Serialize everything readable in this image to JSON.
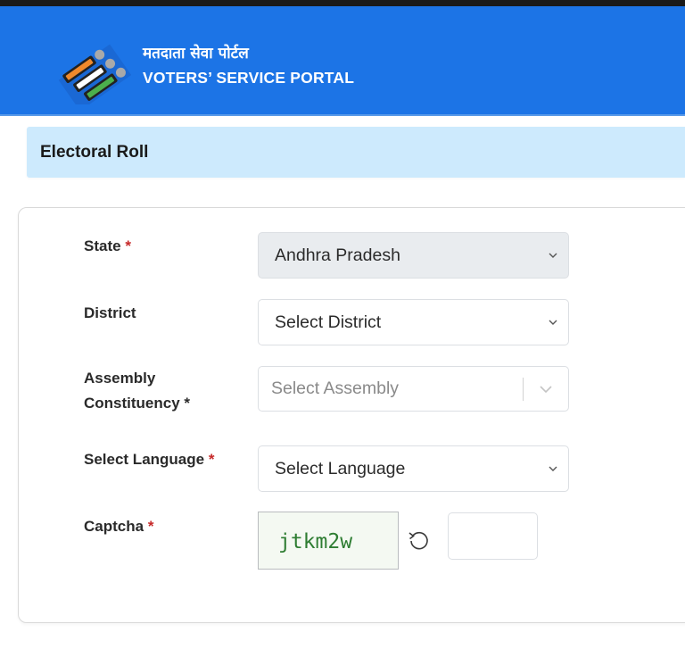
{
  "header": {
    "hindi_title": "मतदाता सेवा पोर्टल",
    "english_title": "VOTERS’ SERVICE PORTAL",
    "logo_icon": "eci-ballot-logo-icon"
  },
  "section": {
    "title": "Electoral Roll"
  },
  "form": {
    "state": {
      "label": "State",
      "required_mark": "*",
      "value": "Andhra Pradesh",
      "disabled": true
    },
    "district": {
      "label": "District",
      "value": "Select District"
    },
    "assembly": {
      "label_line1": "Assembly",
      "label_line2": "Constituency",
      "required_mark": "*",
      "placeholder": "Select Assembly"
    },
    "language": {
      "label": "Select Language",
      "required_mark": "*",
      "value": "Select Language"
    },
    "captcha": {
      "label": "Captcha",
      "required_mark": "*",
      "code": "jtkm2w",
      "input_value": "",
      "refresh_icon": "refresh-icon"
    }
  },
  "colors": {
    "header_blue": "#1c74e6",
    "section_bg": "#cdeafd",
    "required_red": "#c62828",
    "captcha_green": "#2e7d32"
  }
}
